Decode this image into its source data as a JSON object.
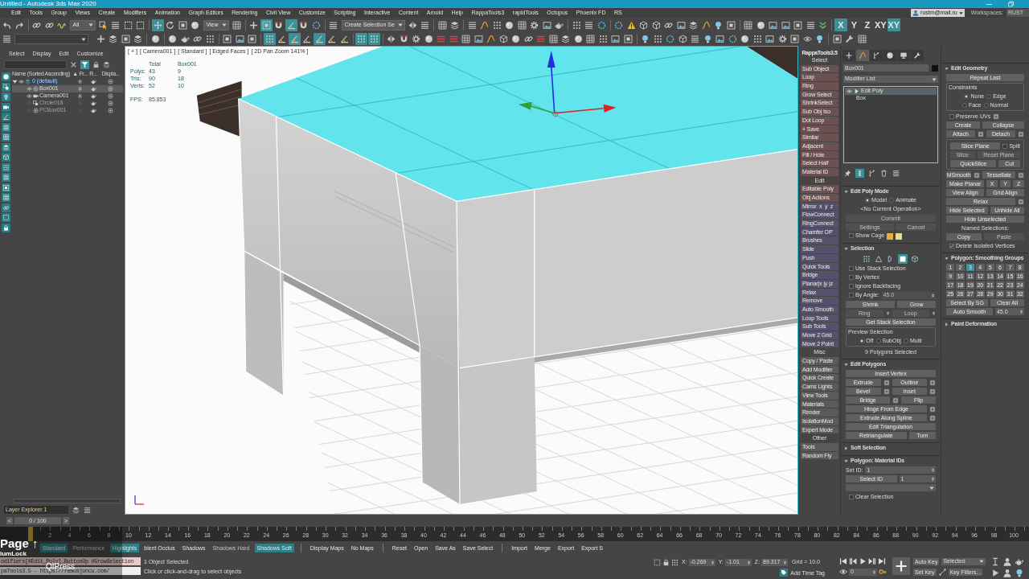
{
  "window": {
    "title": "Untitled - Autodesk 3ds Max 2020"
  },
  "menu": [
    "Edit",
    "Tools",
    "Group",
    "Views",
    "Create",
    "Modifiers",
    "Animation",
    "Graph Editors",
    "Rendering",
    "Civil View",
    "Customize",
    "Scripting",
    "Interactive",
    "Content",
    "Arnold",
    "Help",
    "RappaTools3",
    "rapidTools",
    "Octopus",
    "Phoenix FD",
    "RS"
  ],
  "account": {
    "user": "rustm@mail.ru",
    "workspaces_label": "Workspaces:",
    "workspace": "RUST"
  },
  "toolbar_top": [
    {
      "kind": "icon",
      "on": false
    },
    {
      "kind": "icon",
      "on": false
    },
    {
      "kind": "sep"
    },
    {
      "kind": "icon",
      "on": false
    },
    {
      "kind": "icon",
      "on": false
    },
    {
      "kind": "icon",
      "on": false
    },
    {
      "kind": "dropdown",
      "value": "All"
    },
    {
      "kind": "icon",
      "on": false
    },
    {
      "kind": "icon",
      "on": false
    },
    {
      "kind": "icon",
      "on": false
    },
    {
      "kind": "icon",
      "on": false
    },
    {
      "kind": "sep"
    },
    {
      "kind": "icon",
      "on": true
    },
    {
      "kind": "icon",
      "on": false
    },
    {
      "kind": "icon",
      "on": false
    },
    {
      "kind": "icon",
      "on": false
    },
    {
      "kind": "dropdown",
      "value": "View"
    },
    {
      "kind": "icon",
      "on": false
    },
    {
      "kind": "sep"
    },
    {
      "kind": "icon",
      "on": false
    },
    {
      "kind": "icon",
      "on": true
    },
    {
      "kind": "icon",
      "on": false
    },
    {
      "kind": "icon",
      "on": true
    },
    {
      "kind": "icon",
      "on": false
    },
    {
      "kind": "icon",
      "on": false
    },
    {
      "kind": "sep"
    },
    {
      "kind": "icon",
      "on": false
    },
    {
      "kind": "dropdown",
      "value": "Create Selection Se"
    },
    {
      "kind": "icon",
      "on": false
    },
    {
      "kind": "icon",
      "on": false
    },
    {
      "kind": "sep"
    },
    {
      "kind": "icon",
      "on": false
    },
    {
      "kind": "icon",
      "on": false
    },
    {
      "kind": "sep"
    },
    {
      "kind": "icon",
      "on": false
    },
    {
      "kind": "icon",
      "on": false
    },
    {
      "kind": "icon",
      "on": false
    },
    {
      "kind": "icon",
      "on": false
    },
    {
      "kind": "icon",
      "on": false
    },
    {
      "kind": "icon",
      "on": false
    },
    {
      "kind": "icon",
      "on": false
    },
    {
      "kind": "icon",
      "on": false
    },
    {
      "kind": "sep"
    },
    {
      "kind": "icon",
      "on": false
    },
    {
      "kind": "icon",
      "on": false
    },
    {
      "kind": "icon",
      "on": false
    },
    {
      "kind": "sep"
    },
    {
      "kind": "icon",
      "on": false
    },
    {
      "kind": "icon",
      "on": false
    },
    {
      "kind": "icon",
      "on": false
    },
    {
      "kind": "icon",
      "on": false
    },
    {
      "kind": "icon",
      "on": false
    },
    {
      "kind": "icon",
      "on": false
    },
    {
      "kind": "icon",
      "on": false
    },
    {
      "kind": "icon",
      "on": false
    },
    {
      "kind": "icon",
      "on": false
    },
    {
      "kind": "icon",
      "on": false
    },
    {
      "kind": "sep"
    },
    {
      "kind": "icon",
      "on": false
    },
    {
      "kind": "icon",
      "on": false
    },
    {
      "kind": "icon",
      "on": false
    },
    {
      "kind": "icon",
      "on": false
    },
    {
      "kind": "icon",
      "on": false
    },
    {
      "kind": "icon",
      "on": false
    },
    {
      "kind": "icon",
      "on": false
    },
    {
      "kind": "sep"
    },
    {
      "kind": "letter",
      "label": "X",
      "on": true
    },
    {
      "kind": "letter",
      "label": "Y",
      "on": false
    },
    {
      "kind": "letter",
      "label": "Z",
      "on": false
    },
    {
      "kind": "letter",
      "label": "XY",
      "on": false
    },
    {
      "kind": "letter",
      "label": "XY",
      "on": true
    }
  ],
  "toolbar_second": [
    {
      "kind": "icon",
      "on": false
    },
    {
      "kind": "field"
    },
    {
      "kind": "icon",
      "on": false
    },
    {
      "kind": "icon",
      "on": false
    },
    {
      "kind": "icon",
      "on": false
    },
    {
      "kind": "icon",
      "on": false
    },
    {
      "kind": "sep"
    },
    {
      "kind": "icon",
      "on": false
    },
    {
      "kind": "sep"
    },
    {
      "kind": "icon",
      "on": false
    },
    {
      "kind": "icon",
      "on": false
    },
    {
      "kind": "icon",
      "on": false
    },
    {
      "kind": "icon",
      "on": false
    },
    {
      "kind": "sep"
    },
    {
      "kind": "icon",
      "on": false
    },
    {
      "kind": "icon",
      "on": false
    },
    {
      "kind": "icon",
      "on": false
    },
    {
      "kind": "sep"
    },
    {
      "kind": "icon",
      "on": true
    },
    {
      "kind": "icon",
      "on": false
    },
    {
      "kind": "icon",
      "on": true
    },
    {
      "kind": "icon",
      "on": false
    },
    {
      "kind": "icon",
      "on": true
    },
    {
      "kind": "icon",
      "on": false
    },
    {
      "kind": "icon",
      "on": false
    },
    {
      "kind": "sep"
    },
    {
      "kind": "icon",
      "on": true
    },
    {
      "kind": "icon",
      "on": true
    },
    {
      "kind": "sep"
    },
    {
      "kind": "icon",
      "on": false
    },
    {
      "kind": "icon",
      "on": false
    },
    {
      "kind": "icon",
      "on": false
    },
    {
      "kind": "icon",
      "on": false
    },
    {
      "kind": "icon",
      "on": false
    },
    {
      "kind": "icon",
      "on": false
    },
    {
      "kind": "icon",
      "on": false
    },
    {
      "kind": "icon",
      "on": false
    },
    {
      "kind": "icon",
      "on": false
    },
    {
      "kind": "icon",
      "on": false
    },
    {
      "kind": "icon",
      "on": false
    },
    {
      "kind": "icon",
      "on": false
    },
    {
      "kind": "icon",
      "on": false
    },
    {
      "kind": "icon",
      "on": false
    },
    {
      "kind": "icon",
      "on": false
    },
    {
      "kind": "icon",
      "on": false
    },
    {
      "kind": "icon",
      "on": false
    },
    {
      "kind": "icon",
      "on": false
    },
    {
      "kind": "icon",
      "on": false
    },
    {
      "kind": "icon",
      "on": false
    },
    {
      "kind": "sep"
    },
    {
      "kind": "icon",
      "on": false
    },
    {
      "kind": "icon",
      "on": false
    },
    {
      "kind": "icon",
      "on": false
    },
    {
      "kind": "icon",
      "on": false
    },
    {
      "kind": "icon",
      "on": false
    },
    {
      "kind": "icon",
      "on": false
    },
    {
      "kind": "icon",
      "on": false
    },
    {
      "kind": "icon",
      "on": false
    },
    {
      "kind": "icon",
      "on": false
    },
    {
      "kind": "icon",
      "on": false
    },
    {
      "kind": "icon",
      "on": false
    },
    {
      "kind": "icon",
      "on": false
    },
    {
      "kind": "icon",
      "on": false
    },
    {
      "kind": "icon",
      "on": false
    },
    {
      "kind": "icon",
      "on": false
    },
    {
      "kind": "sep"
    },
    {
      "kind": "icon",
      "on": false
    },
    {
      "kind": "icon",
      "on": false
    },
    {
      "kind": "icon",
      "on": false
    }
  ],
  "scene_explorer": {
    "menu": [
      "Select",
      "Display",
      "Edit",
      "Customize"
    ],
    "columns": [
      "Name (Sorted Ascending)",
      "▲ Fr...",
      "R...",
      "Displa..."
    ],
    "tree": [
      {
        "kind": "layer",
        "name": "0 (default)",
        "expanded": true,
        "selected": false,
        "hidden": false,
        "children": [
          {
            "kind": "geometry",
            "name": "Box001",
            "selected": true,
            "hidden": false
          },
          {
            "kind": "camera",
            "name": "Camera001",
            "selected": false,
            "hidden": false
          },
          {
            "kind": "shape",
            "name": "Circle018",
            "selected": false,
            "hidden": true
          },
          {
            "kind": "geometry",
            "name": "PCBox001",
            "selected": false,
            "hidden": true
          }
        ]
      }
    ],
    "explorer_name": "Layer Explorer 1"
  },
  "viewport": {
    "labels": [
      "[ + ]",
      "[ Camera001 ]",
      "[ Standard ]",
      "[ Edged Faces ]",
      "[ 2D Pan Zoom 141% ]"
    ],
    "stats": {
      "header": [
        "Total",
        "Box001"
      ],
      "rows": [
        [
          "Polys:",
          "43",
          "9"
        ],
        [
          "Tris:",
          "90",
          "18"
        ],
        [
          "Verts:",
          "52",
          "10"
        ]
      ],
      "fps": [
        "FPS:",
        "85.853"
      ]
    }
  },
  "rappatools": {
    "items": [
      {
        "kind": "title",
        "label": "RappaTools3.5"
      },
      {
        "kind": "header",
        "label": "Select"
      },
      {
        "kind": "button",
        "label": "Sub Object",
        "color": "#6b5151"
      },
      {
        "kind": "button",
        "label": "Loop",
        "color": "#6b5151"
      },
      {
        "kind": "button",
        "label": "Ring",
        "color": "#6b5151"
      },
      {
        "kind": "button",
        "label": "Grow Select",
        "color": "#6b5151"
      },
      {
        "kind": "button",
        "label": "ShrinkSelect",
        "color": "#6b5151"
      },
      {
        "kind": "button",
        "label": "Sub Obj Iso",
        "color": "#6b5151"
      },
      {
        "kind": "button",
        "label": "Dot Loop",
        "color": "#6b5151"
      },
      {
        "kind": "button",
        "label": "+ Save",
        "color": "#6b5151"
      },
      {
        "kind": "button",
        "label": "Similar",
        "color": "#6b5151"
      },
      {
        "kind": "button",
        "label": "Adjacent",
        "color": "#6b5151"
      },
      {
        "kind": "button",
        "label": "Fill / Hole",
        "color": "#6b5151"
      },
      {
        "kind": "button",
        "label": "Select Half",
        "color": "#6b5151"
      },
      {
        "kind": "button",
        "label": "Material ID",
        "color": "#6b5151"
      },
      {
        "kind": "header",
        "label": "Edit"
      },
      {
        "kind": "button",
        "label": "Editable Poly",
        "color": "#6b5151"
      },
      {
        "kind": "button",
        "label": "Obj Actions",
        "color": "#6b5151"
      },
      {
        "kind": "button",
        "label": "Mirror  x  y  z",
        "color": "#53526a"
      },
      {
        "kind": "button",
        "label": "FlowConnect",
        "color": "#53526a"
      },
      {
        "kind": "button",
        "label": "RingConnect",
        "color": "#53526a"
      },
      {
        "kind": "button",
        "label": "Chamfer OP",
        "color": "#53526a"
      },
      {
        "kind": "button",
        "label": "Brushes",
        "color": "#53526a"
      },
      {
        "kind": "button",
        "label": "Slide",
        "color": "#53526a"
      },
      {
        "kind": "button",
        "label": "Push",
        "color": "#53526a"
      },
      {
        "kind": "button",
        "label": "Quick Tools",
        "color": "#53526a"
      },
      {
        "kind": "button",
        "label": "Bridge",
        "color": "#53526a"
      },
      {
        "kind": "button",
        "label": "Planar|x |y |z",
        "color": "#53526a"
      },
      {
        "kind": "button",
        "label": "Relax",
        "color": "#53526a"
      },
      {
        "kind": "button",
        "label": "Remove",
        "color": "#53526a"
      },
      {
        "kind": "button",
        "label": "Auto Smooth",
        "color": "#53526a"
      },
      {
        "kind": "button",
        "label": "Loop Tools",
        "color": "#53526a"
      },
      {
        "kind": "button",
        "label": "Sub Tools",
        "color": "#53526a"
      },
      {
        "kind": "button",
        "label": "Move 2 Grid",
        "color": "#53526a"
      },
      {
        "kind": "button",
        "label": "Move 2 Point",
        "color": "#53526a"
      },
      {
        "kind": "header",
        "label": "Misc"
      },
      {
        "kind": "button",
        "label": "Copy / Paste",
        "color": "#5a5a5a"
      },
      {
        "kind": "button",
        "label": "Add Modifier",
        "color": "#5a5a5a"
      },
      {
        "kind": "button",
        "label": "Quick Create",
        "color": "#5a5a5a"
      },
      {
        "kind": "button",
        "label": "Cams Lights",
        "color": "#5a5a5a"
      },
      {
        "kind": "button",
        "label": "View Tools",
        "color": "#5a5a5a"
      },
      {
        "kind": "button",
        "label": "Materials",
        "color": "#5a5a5a"
      },
      {
        "kind": "button",
        "label": "Render",
        "color": "#5a5a5a"
      },
      {
        "kind": "button",
        "label": "IsolationMod",
        "color": "#5a5a5a"
      },
      {
        "kind": "button",
        "label": "Expert Mode",
        "color": "#5a5a5a"
      },
      {
        "kind": "header",
        "label": "Other"
      },
      {
        "kind": "button",
        "label": "Tools",
        "color": "#5a5a5a"
      },
      {
        "kind": "button",
        "label": "Random Fly",
        "color": "#5a5a5a"
      }
    ]
  },
  "command_panel": {
    "tabs": [
      {
        "selected": false
      },
      {
        "selected": true
      },
      {
        "selected": false
      },
      {
        "selected": false
      },
      {
        "selected": false
      },
      {
        "selected": false
      }
    ],
    "object_name": "Box001",
    "modifier_list": "Modifier List",
    "stack": [
      {
        "kind": "modifier",
        "label": "Edit Poly",
        "selected": true
      },
      {
        "kind": "base",
        "label": "Box",
        "selected": false
      }
    ],
    "stack_tools": [
      {
        "on": false
      },
      {
        "on": true
      },
      {
        "on": false
      },
      {
        "on": false
      },
      {
        "on": false
      }
    ],
    "rollouts": [
      {
        "title": "Edit Poly Mode",
        "expanded": true,
        "rows": [
          {
            "controls": [
              {
                "kind": "radio",
                "label": "Model",
                "selected": true
              },
              {
                "kind": "radio",
                "label": "Animate",
                "selected": false
              }
            ]
          },
          {
            "controls": [
              {
                "kind": "text",
                "label": "<No Current Operation>"
              }
            ]
          },
          {
            "controls": [
              {
                "kind": "button",
                "label": "Commit",
                "disabled": true
              }
            ]
          },
          {
            "controls": [
              {
                "kind": "button",
                "label": "Settings",
                "disabled": true
              },
              {
                "kind": "button",
                "label": "Cancel",
                "disabled": true
              }
            ]
          },
          {
            "controls": [
              {
                "kind": "check",
                "label": "Show Cage",
                "checked": false
              },
              {
                "kind": "swatch",
                "color": "#e0b040"
              },
              {
                "kind": "swatch",
                "color": "#e8dc90"
              }
            ]
          }
        ]
      },
      {
        "title": "Selection",
        "expanded": true,
        "rows": [
          {
            "controls": [
              {
                "kind": "subobj",
                "selected": false
              },
              {
                "kind": "subobj",
                "selected": false
              },
              {
                "kind": "subobj",
                "selected": false
              },
              {
                "kind": "subobj",
                "selected": true
              },
              {
                "kind": "subobj",
                "selected": false
              }
            ]
          },
          {
            "controls": [
              {
                "kind": "check",
                "label": "Use Stack Selection",
                "checked": false
              }
            ]
          },
          {
            "controls": [
              {
                "kind": "check",
                "label": "By Vertex",
                "checked": false
              }
            ]
          },
          {
            "controls": [
              {
                "kind": "check",
                "label": "Ignore Backfacing",
                "checked": false
              }
            ]
          },
          {
            "controls": [
              {
                "kind": "check",
                "label": "By Angle:",
                "checked": false
              },
              {
                "kind": "spinner",
                "value": "45.0",
                "disabled": true
              }
            ]
          },
          {
            "controls": [
              {
                "kind": "button",
                "label": "Shrink",
                "disabled": false
              },
              {
                "kind": "button",
                "label": "Grow",
                "disabled": false
              }
            ]
          },
          {
            "controls": [
              {
                "kind": "button",
                "label": "Ring",
                "disabled": true
              },
              {
                "kind": "arrows"
              },
              {
                "kind": "button",
                "label": "Loop",
                "disabled": true
              },
              {
                "kind": "arrows"
              }
            ]
          },
          {
            "controls": [
              {
                "kind": "button",
                "label": "Get Stack Selection",
                "disabled": false
              }
            ]
          },
          {
            "controls": [
              {
                "kind": "group",
                "title": "Preview Selection",
                "rows": [
                  {
                    "controls": [
                      {
                        "kind": "radio",
                        "label": "Off",
                        "selected": true
                      },
                      {
                        "kind": "radio",
                        "label": "SubObj",
                        "selected": false
                      },
                      {
                        "kind": "radio",
                        "label": "Multi",
                        "selected": false
                      }
                    ]
                  }
                ]
              }
            ]
          },
          {
            "controls": [
              {
                "kind": "text",
                "label": "9 Polygons Selected"
              }
            ]
          }
        ]
      },
      {
        "title": "Edit Polygons",
        "expanded": true,
        "rows": [
          {
            "controls": [
              {
                "kind": "button",
                "label": "Insert Vertex",
                "disabled": false
              }
            ]
          },
          {
            "controls": [
              {
                "kind": "button",
                "label": "Extrude",
                "disabled": false
              },
              {
                "kind": "settings"
              },
              {
                "kind": "button",
                "label": "Outline",
                "disabled": false
              },
              {
                "kind": "settings"
              }
            ]
          },
          {
            "controls": [
              {
                "kind": "button",
                "label": "Bevel",
                "disabled": false
              },
              {
                "kind": "settings"
              },
              {
                "kind": "button",
                "label": "Inset",
                "disabled": false
              },
              {
                "kind": "settings"
              }
            ]
          },
          {
            "controls": [
              {
                "kind": "button",
                "label": "Bridge",
                "disabled": false
              },
              {
                "kind": "settings"
              },
              {
                "kind": "button",
                "label": "Flip",
                "disabled": false
              }
            ]
          },
          {
            "controls": [
              {
                "kind": "button",
                "label": "Hinge From Edge",
                "disabled": false
              },
              {
                "kind": "settings"
              }
            ]
          },
          {
            "controls": [
              {
                "kind": "button",
                "label": "Extrude Along Spline",
                "disabled": false
              },
              {
                "kind": "settings"
              }
            ]
          },
          {
            "controls": [
              {
                "kind": "button",
                "label": "Edit Triangulation",
                "disabled": false
              }
            ]
          },
          {
            "controls": [
              {
                "kind": "button",
                "label": "Retriangulate",
                "disabled": false
              },
              {
                "kind": "button",
                "label": "Turn",
                "disabled": false
              }
            ]
          }
        ]
      },
      {
        "title": "Soft Selection",
        "expanded": false
      },
      {
        "title": "Polygon: Material IDs",
        "expanded": true,
        "rows": [
          {
            "controls": [
              {
                "kind": "text",
                "label": "Set ID:"
              },
              {
                "kind": "spinner",
                "value": "1",
                "disabled": false
              }
            ]
          },
          {
            "controls": [
              {
                "kind": "button",
                "label": "Select ID",
                "disabled": false
              },
              {
                "kind": "spinner",
                "value": "1",
                "disabled": false
              }
            ]
          },
          {
            "controls": [
              {
                "kind": "dropdown"
              }
            ]
          },
          {
            "controls": [
              {
                "kind": "check",
                "label": "Clear Selection",
                "checked": false
              }
            ]
          }
        ]
      }
    ]
  },
  "geometry_panel": {
    "rollouts": [
      {
        "title": "Edit Geometry",
        "expanded": true,
        "rows": [
          {
            "controls": [
              {
                "kind": "button",
                "label": "Repeat Last",
                "disabled": false
              }
            ]
          },
          {
            "controls": [
              {
                "kind": "group",
                "title": "Constraints",
                "rows": [
                  {
                    "controls": [
                      {
                        "kind": "radio",
                        "label": "None",
                        "selected": true
                      },
                      {
                        "kind": "radio",
                        "label": "Edge",
                        "selected": false
                      }
                    ]
                  },
                  {
                    "controls": [
                      {
                        "kind": "radio",
                        "label": "Face",
                        "selected": false
                      },
                      {
                        "kind": "radio",
                        "label": "Normal",
                        "selected": false
                      }
                    ]
                  }
                ]
              }
            ]
          },
          {
            "controls": [
              {
                "kind": "check",
                "label": "Preserve UVs",
                "checked": false
              },
              {
                "kind": "settings"
              }
            ]
          },
          {
            "controls": [
              {
                "kind": "button",
                "label": "Create",
                "disabled": false
              },
              {
                "kind": "button",
                "label": "Collapse",
                "disabled": false
              }
            ]
          },
          {
            "controls": [
              {
                "kind": "button",
                "label": "Attach",
                "disabled": false
              },
              {
                "kind": "settings"
              },
              {
                "kind": "button",
                "label": "Detach",
                "disabled": false
              },
              {
                "kind": "settings"
              }
            ]
          },
          {
            "controls": [
              {
                "kind": "group",
                "rows": [
                  {
                    "controls": [
                      {
                        "kind": "button",
                        "label": "Slice Plane",
                        "disabled": false
                      },
                      {
                        "kind": "check",
                        "label": "Split",
                        "checked": false
                      }
                    ]
                  },
                  {
                    "controls": [
                      {
                        "kind": "button",
                        "label": "Slice",
                        "disabled": true
                      },
                      {
                        "kind": "button",
                        "label": "Reset Plane",
                        "disabled": true
                      }
                    ]
                  },
                  {
                    "controls": [
                      {
                        "kind": "button",
                        "label": "QuickSlice",
                        "disabled": false
                      },
                      {
                        "kind": "button",
                        "label": "Cut",
                        "disabled": false
                      }
                    ]
                  }
                ]
              }
            ]
          },
          {
            "controls": [
              {
                "kind": "button",
                "label": "MSmooth",
                "disabled": false
              },
              {
                "kind": "settings"
              },
              {
                "kind": "button",
                "label": "Tessellate",
                "disabled": false
              },
              {
                "kind": "settings"
              }
            ]
          },
          {
            "controls": [
              {
                "kind": "button",
                "label": "Make Planar",
                "disabled": false
              },
              {
                "kind": "button",
                "label": "X",
                "disabled": false
              },
              {
                "kind": "button",
                "label": "Y",
                "disabled": false
              },
              {
                "kind": "button",
                "label": "Z",
                "disabled": false
              }
            ]
          },
          {
            "controls": [
              {
                "kind": "button",
                "label": "View Align",
                "disabled": false
              },
              {
                "kind": "button",
                "label": "Grid Align",
                "disabled": false
              }
            ]
          },
          {
            "controls": [
              {
                "kind": "button",
                "label": "Relax",
                "disabled": false
              },
              {
                "kind": "settings"
              }
            ]
          },
          {
            "controls": [
              {
                "kind": "button",
                "label": "Hide Selected",
                "disabled": false
              },
              {
                "kind": "button",
                "label": "Unhide All",
                "disabled": false
              }
            ]
          },
          {
            "controls": [
              {
                "kind": "button",
                "label": "Hide Unselected",
                "disabled": false
              }
            ]
          },
          {
            "controls": [
              {
                "kind": "text",
                "label": "Named Selections:"
              }
            ]
          },
          {
            "controls": [
              {
                "kind": "button",
                "label": "Copy",
                "disabled": false
              },
              {
                "kind": "button",
                "label": "Paste",
                "disabled": true
              }
            ]
          },
          {
            "controls": [
              {
                "kind": "check",
                "label": "Delete Isolated Vertices",
                "checked": true
              }
            ]
          }
        ]
      },
      {
        "title": "Polygon: Smoothing Groups",
        "expanded": true,
        "rows": [
          {
            "controls": [
              {
                "kind": "toggle",
                "label": "1",
                "selected": false
              },
              {
                "kind": "toggle",
                "label": "2",
                "selected": false
              },
              {
                "kind": "toggle",
                "label": "3",
                "selected": true
              },
              {
                "kind": "toggle",
                "label": "4",
                "selected": false
              },
              {
                "kind": "toggle",
                "label": "5",
                "selected": false
              },
              {
                "kind": "toggle",
                "label": "6",
                "selected": false
              },
              {
                "kind": "toggle",
                "label": "7",
                "selected": false
              },
              {
                "kind": "toggle",
                "label": "8",
                "selected": false
              }
            ]
          },
          {
            "controls": [
              {
                "kind": "toggle",
                "label": "9",
                "selected": false
              },
              {
                "kind": "toggle",
                "label": "10",
                "selected": false
              },
              {
                "kind": "toggle",
                "label": "11",
                "selected": false
              },
              {
                "kind": "toggle",
                "label": "12",
                "selected": false
              },
              {
                "kind": "toggle",
                "label": "13",
                "selected": false
              },
              {
                "kind": "toggle",
                "label": "14",
                "selected": false
              },
              {
                "kind": "toggle",
                "label": "15",
                "selected": false
              },
              {
                "kind": "toggle",
                "label": "16",
                "selected": false
              }
            ]
          },
          {
            "controls": [
              {
                "kind": "toggle",
                "label": "17",
                "selected": false
              },
              {
                "kind": "toggle",
                "label": "18",
                "selected": false
              },
              {
                "kind": "toggle",
                "label": "19",
                "selected": false
              },
              {
                "kind": "toggle",
                "label": "20",
                "selected": false
              },
              {
                "kind": "toggle",
                "label": "21",
                "selected": false
              },
              {
                "kind": "toggle",
                "label": "22",
                "selected": false
              },
              {
                "kind": "toggle",
                "label": "23",
                "selected": false
              },
              {
                "kind": "toggle",
                "label": "24",
                "selected": false
              }
            ]
          },
          {
            "controls": [
              {
                "kind": "toggle",
                "label": "25",
                "selected": false
              },
              {
                "kind": "toggle",
                "label": "26",
                "selected": false
              },
              {
                "kind": "toggle",
                "label": "27",
                "selected": false
              },
              {
                "kind": "toggle",
                "label": "28",
                "selected": false
              },
              {
                "kind": "toggle",
                "label": "29",
                "selected": false
              },
              {
                "kind": "toggle",
                "label": "30",
                "selected": false
              },
              {
                "kind": "toggle",
                "label": "31",
                "selected": false
              },
              {
                "kind": "toggle",
                "label": "32",
                "selected": false
              }
            ]
          },
          {
            "controls": [
              {
                "kind": "button",
                "label": "Select By SG",
                "disabled": false
              },
              {
                "kind": "button",
                "label": "Clear All",
                "disabled": false
              }
            ]
          },
          {
            "controls": [
              {
                "kind": "button",
                "label": "Auto Smooth",
                "disabled": false
              },
              {
                "kind": "spinner",
                "value": "45.0",
                "disabled": false
              }
            ]
          }
        ]
      },
      {
        "title": "Paint Deformation",
        "expanded": false
      }
    ]
  },
  "time_slider": {
    "prev": "<",
    "frame": "0 / 100",
    "next": ">"
  },
  "track_bar": {
    "labels": [
      "2",
      "4",
      "6",
      "8",
      "10",
      "12",
      "14",
      "16",
      "18",
      "20",
      "22",
      "24",
      "26",
      "28",
      "30",
      "32",
      "34",
      "36",
      "38",
      "40",
      "42",
      "44",
      "46",
      "48",
      "50",
      "52",
      "54",
      "56",
      "58",
      "60",
      "62",
      "64",
      "66",
      "68",
      "70",
      "72",
      "74",
      "76",
      "78",
      "80",
      "82",
      "84",
      "86",
      "88",
      "90",
      "92",
      "94",
      "96",
      "98",
      "100"
    ]
  },
  "display_bar": [
    {
      "kind": "button",
      "label": "Standard",
      "on": true,
      "disabled": false
    },
    {
      "kind": "button",
      "label": "Performance",
      "on": false,
      "disabled": true
    },
    {
      "kind": "button",
      "label": "Highlights",
      "on": true,
      "disabled": false
    },
    {
      "kind": "button",
      "label": "bient Occlus",
      "on": false,
      "disabled": false
    },
    {
      "kind": "button",
      "label": "Shadows",
      "on": false,
      "disabled": false
    },
    {
      "kind": "button",
      "label": "Shadows Hard",
      "on": false,
      "disabled": true
    },
    {
      "kind": "button",
      "label": "Shadows Soft",
      "on": true,
      "disabled": false
    },
    {
      "kind": "sep"
    },
    {
      "kind": "button",
      "label": "Display Maps",
      "on": false,
      "disabled": false
    },
    {
      "kind": "button",
      "label": "No Maps",
      "on": false,
      "disabled": false
    },
    {
      "kind": "sep"
    },
    {
      "kind": "button",
      "label": "Reset",
      "on": false,
      "disabled": false
    },
    {
      "kind": "button",
      "label": "Open",
      "on": false,
      "disabled": false
    },
    {
      "kind": "button",
      "label": "Save As",
      "on": false,
      "disabled": false
    },
    {
      "kind": "button",
      "label": "Save Select",
      "on": false,
      "disabled": false
    },
    {
      "kind": "sep"
    },
    {
      "kind": "button",
      "label": "Import",
      "on": false,
      "disabled": false
    },
    {
      "kind": "button",
      "label": "Merge",
      "on": false,
      "disabled": false
    },
    {
      "kind": "button",
      "label": "Export",
      "on": false,
      "disabled": false
    },
    {
      "kind": "button",
      "label": "Export S",
      "on": false,
      "disabled": false
    }
  ],
  "status": {
    "listener": [
      "odifiers[#Edit_Poly].ButtonOp #GrowSelection",
      "paTools3.5 - https://remusjuncu.com/"
    ],
    "selection": "1 Object Selected",
    "prompt": "Click or click-and-drag to select objects",
    "coords": [
      {
        "axis": "X:",
        "value": "-0.269"
      },
      {
        "axis": "Y:",
        "value": "-1.01"
      },
      {
        "axis": "Z:",
        "value": "89.317"
      }
    ],
    "grid": "Grid = 10.0",
    "time_tag": "Add Time Tag",
    "frame": "0",
    "auto_key": "Auto Key",
    "key_mode": "Selected",
    "set_key": "Set Key",
    "key_filters": "Key Filters..."
  },
  "key_overlay": [
    "Page ↑",
    "lumLock",
    "QIPress"
  ]
}
